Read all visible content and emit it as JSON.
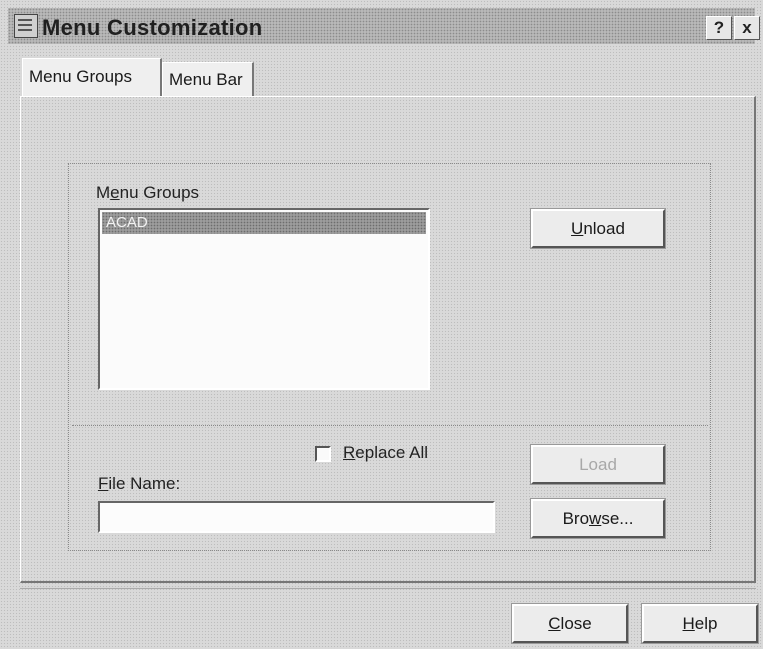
{
  "window": {
    "title": "Menu Customization",
    "help_glyph": "?",
    "close_glyph": "x"
  },
  "tabs": [
    {
      "label": "Menu Groups",
      "active": true
    },
    {
      "label": "Menu Bar",
      "active": false
    }
  ],
  "menu_groups": {
    "label_pre": "M",
    "label_mnemonic": "e",
    "label_post": "nu Groups",
    "items": [
      "ACAD"
    ],
    "selected": "ACAD"
  },
  "buttons": {
    "unload": {
      "mnemonic": "U",
      "rest": "nload"
    },
    "load": {
      "label": "Load",
      "enabled": false
    },
    "browse": {
      "pre": "Bro",
      "mnemonic": "w",
      "rest": "se..."
    },
    "close": {
      "mnemonic": "C",
      "rest": "lose"
    },
    "help": {
      "mnemonic": "H",
      "rest": "elp"
    }
  },
  "replace_all": {
    "mnemonic": "R",
    "rest": "eplace All",
    "checked": false
  },
  "file_name": {
    "label_mnemonic": "F",
    "label_rest": "ile Name:",
    "value": ""
  }
}
